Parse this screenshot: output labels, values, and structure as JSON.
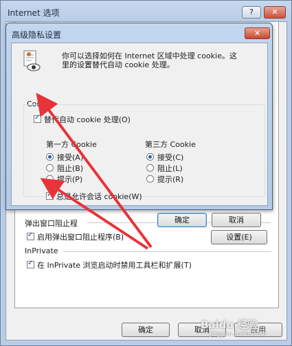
{
  "bg_window": {
    "title": "Internet 选项",
    "help": "?",
    "close": "✕",
    "popup_group": "弹出窗口阻止程",
    "popup_checkbox": "启用弹出窗口阻止程序(B)",
    "settings_button": "设置(E)",
    "inprivate_group": "InPrivate",
    "inprivate_checkbox": "在 InPrivate 浏览启动时禁用工具栏和扩展(T)",
    "ok": "确定",
    "cancel": "取消",
    "apply": "应用"
  },
  "dialog": {
    "title": "高级隐私设置",
    "close": "✕",
    "description_line1": "你可以选择如何在 Internet 区域中处理 cookie。这",
    "description_line2": "里的设置替代自动 cookie 处理。",
    "group_label": "Cookie",
    "override_checkbox": "替代自动 cookie 处理(O)",
    "first_party": {
      "heading": "第一方 Cookie",
      "options": [
        "接受(A)",
        "阻止(B)",
        "提示(P)"
      ],
      "selected": "接受(A)"
    },
    "third_party": {
      "heading": "第三方 Cookie",
      "options": [
        "接受(C)",
        "阻止(L)",
        "提示(R)"
      ],
      "selected": "接受(C)"
    },
    "session_checkbox": "总是允许会话 cookie(W)",
    "ok": "确定",
    "cancel": "取消"
  },
  "watermark": "Baidu 经验",
  "watermark_sub": "jingyan.baidu.com",
  "colors": {
    "arrow": "#e8333a",
    "title_bar": "#b9cde6"
  }
}
